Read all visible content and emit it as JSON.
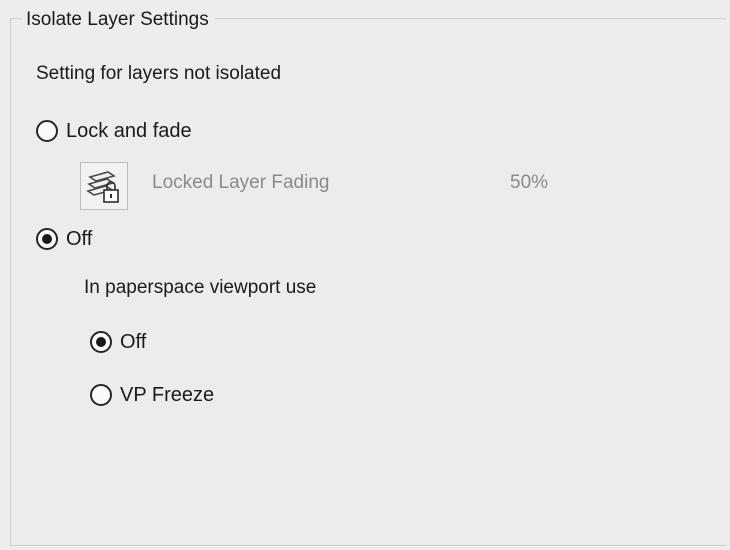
{
  "panel": {
    "title": "Isolate Layer Settings",
    "section_label": "Setting for layers not isolated"
  },
  "options": {
    "lock_and_fade": {
      "label": "Lock and fade",
      "selected": false
    },
    "off": {
      "label": "Off",
      "selected": true
    }
  },
  "fading": {
    "icon": "locked-layer-icon",
    "label": "Locked Layer Fading",
    "value": "50%"
  },
  "paperspace": {
    "label": "In paperspace viewport use",
    "options": {
      "off": {
        "label": "Off",
        "selected": true
      },
      "vp_freeze": {
        "label": "VP Freeze",
        "selected": false
      }
    }
  }
}
